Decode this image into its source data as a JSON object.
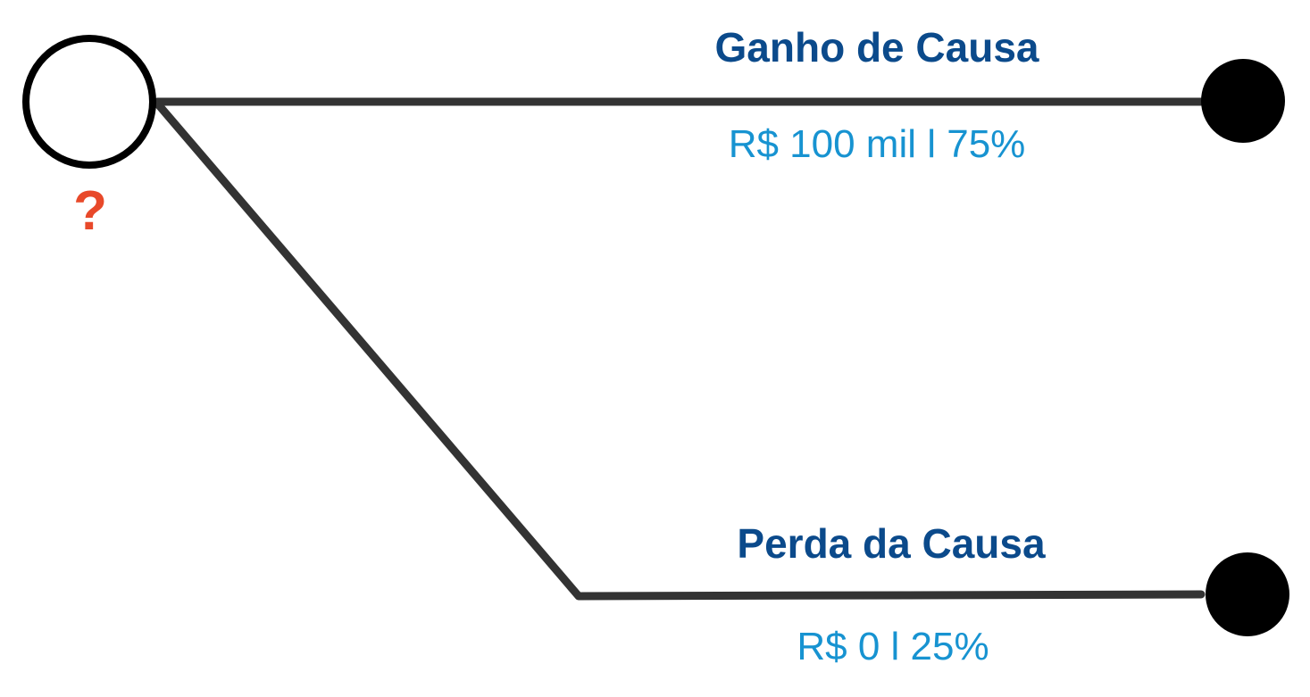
{
  "colors": {
    "line": "#333333",
    "node": "#000000",
    "title": "#0b4a8b",
    "values": "#1793d1",
    "question": "#e8492a",
    "background": "#ffffff"
  },
  "decision_node": {
    "label": "?"
  },
  "branches": [
    {
      "title": "Ganho de Causa",
      "values": "R$ 100 mil  l  75%"
    },
    {
      "title": "Perda da Causa",
      "values": "R$ 0 l 25%"
    }
  ]
}
